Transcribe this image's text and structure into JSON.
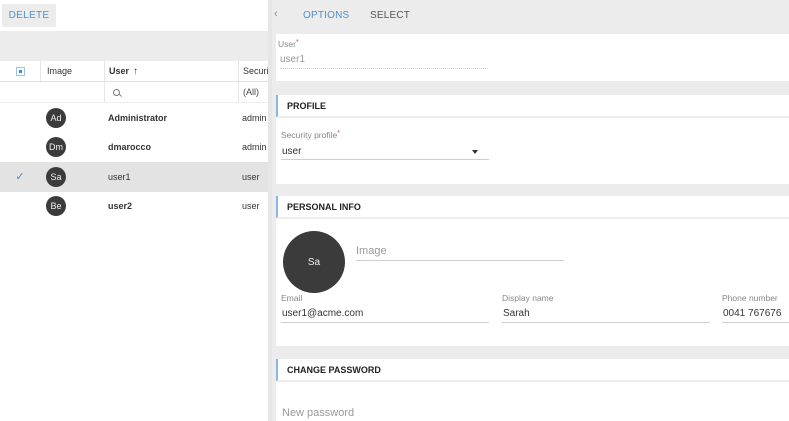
{
  "left": {
    "delete_label": "DELETE",
    "columns": {
      "image": "Image",
      "user": "User",
      "security": "Securit"
    },
    "sort_icon": "↑",
    "filter_all": "(All)",
    "rows": [
      {
        "initials": "Ad",
        "user": "Administrator",
        "security": "admin",
        "bold": true,
        "selected": false
      },
      {
        "initials": "Dm",
        "user": "dmarocco",
        "security": "admin",
        "bold": true,
        "selected": false
      },
      {
        "initials": "Sa",
        "user": "user1",
        "security": "user",
        "bold": false,
        "selected": true
      },
      {
        "initials": "Be",
        "user": "user2",
        "security": "user",
        "bold": true,
        "selected": false
      }
    ],
    "check_mark": "✓"
  },
  "tabs": {
    "back_icon": "‹",
    "options": "OPTIONS",
    "select": "SELECT"
  },
  "user_card": {
    "label": "User",
    "required": "*",
    "value": "user1"
  },
  "profile": {
    "heading": "PROFILE",
    "security_label": "Security profile",
    "required": "*",
    "security_value": "user"
  },
  "personal": {
    "heading": "PERSONAL INFO",
    "avatar_initials": "Sa",
    "image_placeholder": "Image",
    "email_label": "Email",
    "email_value": "user1@acme.com",
    "display_label": "Display name",
    "display_value": "Sarah",
    "phone_label": "Phone number",
    "phone_value": "0041 767676"
  },
  "password": {
    "heading": "CHANGE PASSWORD",
    "new_placeholder": "New password"
  },
  "colors": {
    "accent": "#4f8fd1",
    "avatar": "#3b3b3b",
    "panel_bg": "#ececec",
    "section_border": "#8ab6e6"
  }
}
